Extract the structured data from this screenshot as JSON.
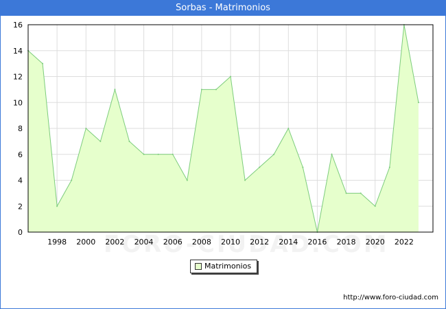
{
  "title": "Sorbas - Matrimonios",
  "source_url": "http://www.foro-ciudad.com",
  "watermark": "FORO-CIUDAD.COM",
  "colors": {
    "header": "#3c78d8",
    "area_fill": "#e6ffcc",
    "area_line": "#7ccc7c",
    "grid": "#dddddd"
  },
  "chart_data": {
    "type": "area",
    "title": "Sorbas - Matrimonios",
    "x": [
      1996,
      1997,
      1998,
      1999,
      2000,
      2001,
      2002,
      2003,
      2004,
      2005,
      2006,
      2007,
      2008,
      2009,
      2010,
      2011,
      2012,
      2013,
      2014,
      2015,
      2016,
      2017,
      2018,
      2019,
      2020,
      2021,
      2022,
      2023
    ],
    "series": [
      {
        "name": "Matrimonios",
        "values": [
          14,
          13,
          2,
          4,
          8,
          7,
          11,
          7,
          6,
          6,
          6,
          4,
          11,
          11,
          12,
          4,
          5,
          6,
          8,
          5,
          0,
          6,
          3,
          3,
          2,
          5,
          16,
          10
        ]
      }
    ],
    "x_ticks": [
      1998,
      2000,
      2002,
      2004,
      2006,
      2008,
      2010,
      2012,
      2014,
      2016,
      2018,
      2020,
      2022
    ],
    "y_ticks": [
      0,
      2,
      4,
      6,
      8,
      10,
      12,
      14,
      16
    ],
    "xlim": [
      1996,
      2024
    ],
    "ylim": [
      0,
      16
    ],
    "grid": true,
    "legend_position": "bottom-center"
  }
}
